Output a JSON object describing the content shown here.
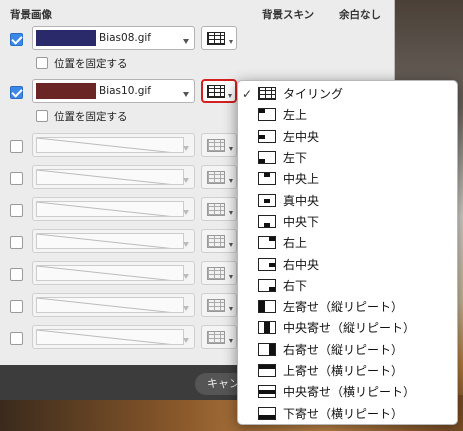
{
  "headers": {
    "bg_image": "背景画像",
    "bg_skin": "背景スキン",
    "no_margin": "余白なし"
  },
  "rows": [
    {
      "checked": true,
      "swatch_color": "#2a2a6a",
      "image_name": "Bias08.gif",
      "fix_label": "位置を固定する"
    },
    {
      "checked": true,
      "swatch_color": "#6a2525",
      "image_name": "Bias10.gif",
      "fix_label": "位置を固定する"
    }
  ],
  "empty_rows": 7,
  "footer": {
    "cancel_label": "キャン"
  },
  "menu": {
    "selected_index": 0,
    "items": [
      {
        "label": "タイリング",
        "icon": "tile-icon"
      },
      {
        "label": "左上",
        "icon": "top-left-icon"
      },
      {
        "label": "左中央",
        "icon": "middle-left-icon"
      },
      {
        "label": "左下",
        "icon": "bottom-left-icon"
      },
      {
        "label": "中央上",
        "icon": "top-center-icon"
      },
      {
        "label": "真中央",
        "icon": "center-icon"
      },
      {
        "label": "中央下",
        "icon": "bottom-center-icon"
      },
      {
        "label": "右上",
        "icon": "top-right-icon"
      },
      {
        "label": "右中央",
        "icon": "middle-right-icon"
      },
      {
        "label": "右下",
        "icon": "bottom-right-icon"
      },
      {
        "label": "左寄せ（縦リピート）",
        "icon": "left-repeat-y-icon"
      },
      {
        "label": "中央寄せ（縦リピート）",
        "icon": "center-repeat-y-icon"
      },
      {
        "label": "右寄せ（縦リピート）",
        "icon": "right-repeat-y-icon"
      },
      {
        "label": "上寄せ（横リピート）",
        "icon": "top-repeat-x-icon"
      },
      {
        "label": "中央寄せ（横リピート）",
        "icon": "middle-repeat-x-icon"
      },
      {
        "label": "下寄せ（横リピート）",
        "icon": "bottom-repeat-x-icon"
      }
    ]
  },
  "colors": {
    "highlight": "#d42020",
    "checkbox_accent": "#3a88e8"
  }
}
